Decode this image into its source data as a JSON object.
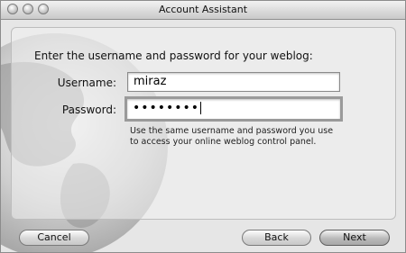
{
  "window": {
    "title": "Account Assistant"
  },
  "form": {
    "heading": "Enter the username and password for your weblog:",
    "username_label": "Username:",
    "username_value": "miraz",
    "password_label": "Password:",
    "password_value": "••••••••",
    "hint_line1": "Use the same username and password you use",
    "hint_line2": "to access your online weblog control panel."
  },
  "buttons": {
    "cancel": "Cancel",
    "back": "Back",
    "next": "Next"
  }
}
